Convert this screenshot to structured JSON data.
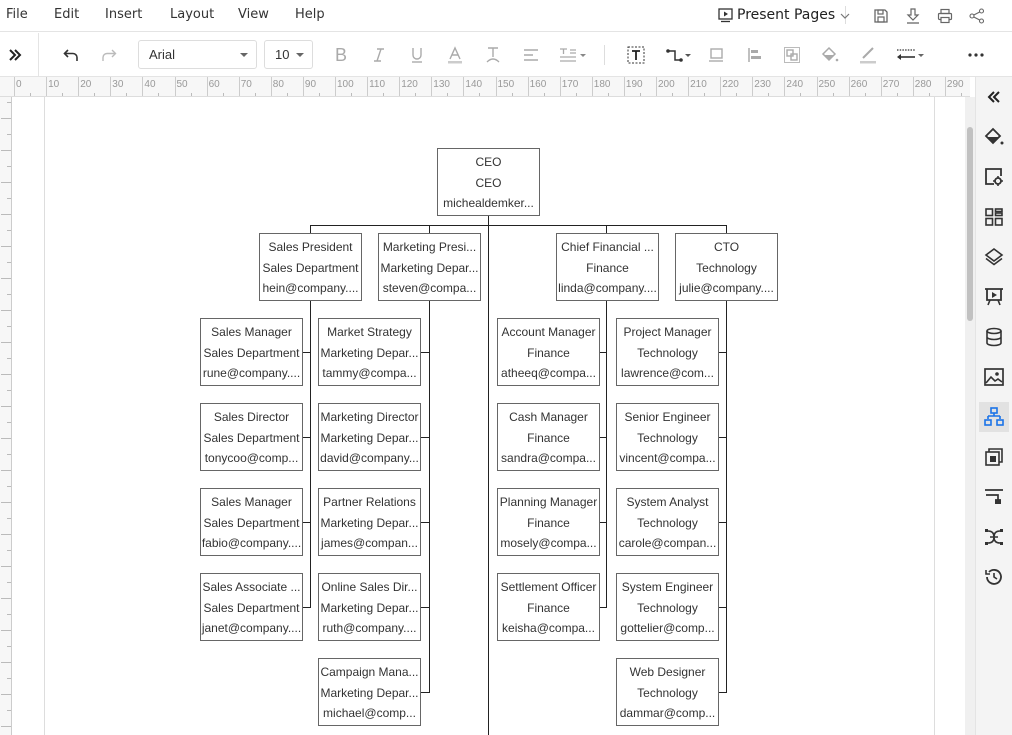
{
  "menubar": {
    "items": [
      "File",
      "Edit",
      "Insert",
      "Layout",
      "View",
      "Help"
    ],
    "present_label": "Present Pages",
    "icons": [
      "save-icon",
      "download-icon",
      "print-icon",
      "share-icon"
    ]
  },
  "toolbar": {
    "font_family": "Arial",
    "font_size": "10",
    "icons": [
      "expand-panel-icon",
      "undo-icon",
      "redo-icon",
      "bold-icon",
      "italic-icon",
      "underline-icon",
      "font-color-icon",
      "text-style-icon",
      "align-icon",
      "line-spacing-icon",
      "text-box-icon",
      "connector-icon",
      "container-icon",
      "align-objects-icon",
      "group-icon",
      "fill-icon",
      "line-color-icon",
      "line-style-icon",
      "more-icon"
    ]
  },
  "ruler": {
    "labels": [
      "0",
      "10",
      "20",
      "30",
      "40",
      "50",
      "60",
      "70",
      "80",
      "90",
      "100",
      "110",
      "120",
      "130",
      "140",
      "150",
      "160",
      "170",
      "180",
      "190",
      "200",
      "210",
      "220",
      "230",
      "240",
      "250",
      "260",
      "270",
      "280",
      "290"
    ]
  },
  "rightbar": {
    "items": [
      "collapse-icon",
      "fill-style-icon",
      "page-setup-icon",
      "symbols-icon",
      "layers-icon",
      "presentation-icon",
      "data-icon",
      "image-icon",
      "org-chart-icon",
      "theme-icon",
      "layout-icon",
      "mind-map-icon",
      "history-icon"
    ],
    "active": "org-chart-icon"
  },
  "orgchart": {
    "ceo": {
      "title": "CEO",
      "dept": "CEO",
      "email": "michealdemker..."
    },
    "columns": [
      {
        "head": {
          "title": "Sales President",
          "dept": "Sales Department",
          "email": "hein@company...."
        },
        "children": [
          {
            "title": "Sales Manager",
            "dept": "Sales Department",
            "email": "rune@company...."
          },
          {
            "title": "Sales Director",
            "dept": "Sales Department",
            "email": "tonycoo@comp..."
          },
          {
            "title": "Sales Manager",
            "dept": "Sales Department",
            "email": "fabio@company...."
          },
          {
            "title": "Sales Associate ...",
            "dept": "Sales Department",
            "email": "janet@company...."
          }
        ]
      },
      {
        "head": {
          "title": "Marketing Presi...",
          "dept": "Marketing Depar...",
          "email": "steven@compa..."
        },
        "children": [
          {
            "title": "Market Strategy",
            "dept": "Marketing Depar...",
            "email": "tammy@compa..."
          },
          {
            "title": "Marketing Director",
            "dept": "Marketing Depar...",
            "email": "david@company..."
          },
          {
            "title": "Partner Relations",
            "dept": "Marketing Depar...",
            "email": "james@compan..."
          },
          {
            "title": "Online Sales Dir...",
            "dept": "Marketing Depar...",
            "email": "ruth@company...."
          },
          {
            "title": "Campaign Mana...",
            "dept": "Marketing Depar...",
            "email": "michael@comp..."
          }
        ]
      },
      {
        "head": {
          "title": "Chief Financial ...",
          "dept": "Finance",
          "email": "linda@company...."
        },
        "children": [
          {
            "title": "Account Manager",
            "dept": "Finance",
            "email": "atheeq@compa..."
          },
          {
            "title": "Cash Manager",
            "dept": "Finance",
            "email": "sandra@compa..."
          },
          {
            "title": "Planning Manager",
            "dept": "Finance",
            "email": "mosely@compa..."
          },
          {
            "title": "Settlement Officer",
            "dept": "Finance",
            "email": "keisha@compa..."
          }
        ]
      },
      {
        "head": {
          "title": "CTO",
          "dept": "Technology",
          "email": "julie@company...."
        },
        "children": [
          {
            "title": "Project Manager",
            "dept": "Technology",
            "email": "lawrence@com..."
          },
          {
            "title": "Senior Engineer",
            "dept": "Technology",
            "email": "vincent@compa..."
          },
          {
            "title": "System Analyst",
            "dept": "Technology",
            "email": "carole@compan..."
          },
          {
            "title": "System Engineer",
            "dept": "Technology",
            "email": "gottelier@comp..."
          },
          {
            "title": "Web Designer",
            "dept": "Technology",
            "email": "dammar@comp..."
          }
        ]
      }
    ]
  }
}
